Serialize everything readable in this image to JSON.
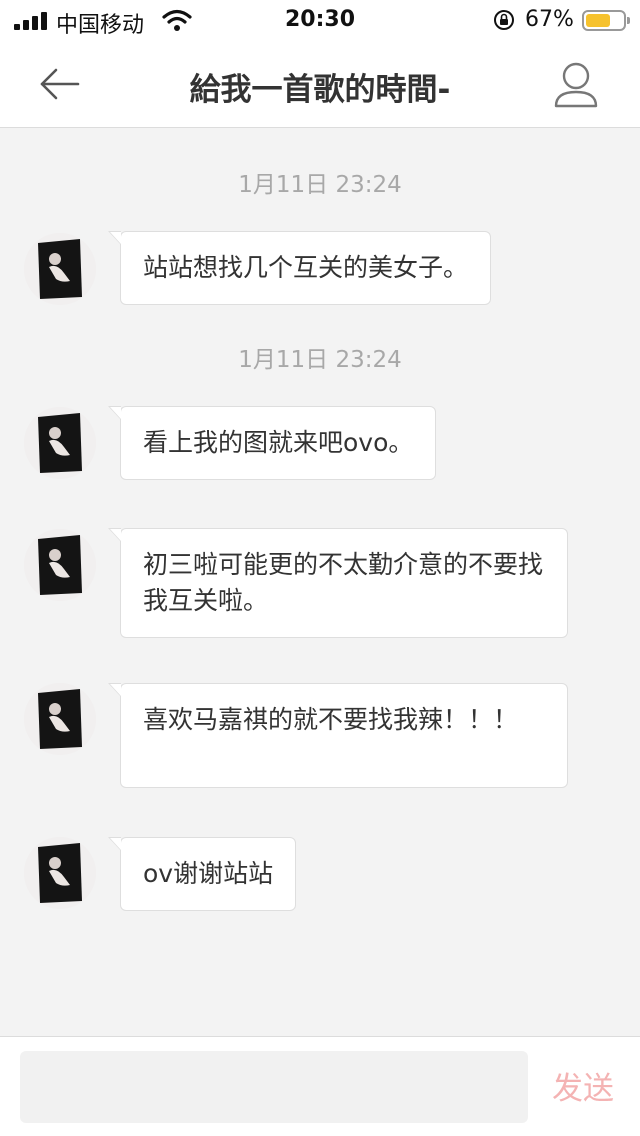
{
  "status_bar": {
    "carrier": "中国移动",
    "time": "20:30",
    "battery_percent": "67%",
    "battery_level": 0.67,
    "battery_color": "#f6c22e"
  },
  "header": {
    "title": "給我一首歌的時間-",
    "back_icon": "arrow-left-icon",
    "profile_icon": "person-icon"
  },
  "messages": [
    {
      "timestamp": "1月11日 23:24",
      "text": "站站想找几个互关的美女子。"
    },
    {
      "timestamp": "1月11日 23:24",
      "text": "看上我的图就来吧ovo。"
    },
    {
      "text": "初三啦可能更的不太勤介意的不要找我互关啦。"
    },
    {
      "text": "喜欢马嘉祺的就不要找我辣！！！"
    },
    {
      "text": "ov谢谢站站"
    }
  ],
  "input_bar": {
    "placeholder": "",
    "value": "",
    "send_label": "发送",
    "send_color": "#f4b3b3"
  }
}
